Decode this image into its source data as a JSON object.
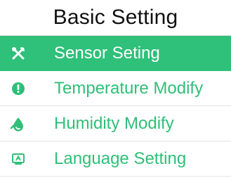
{
  "header": {
    "title": "Basic Setting"
  },
  "theme": {
    "accent": "#2fc07a",
    "active_text": "#ffffff",
    "text": "#2fbf78"
  },
  "menu": {
    "items": [
      {
        "label": "Sensor Seting",
        "icon": "tools-icon",
        "selected": true
      },
      {
        "label": "Temperature Modify",
        "icon": "thermometer-info-icon",
        "selected": false
      },
      {
        "label": "Humidity Modify",
        "icon": "droplet-icon",
        "selected": false
      },
      {
        "label": "Language Setting",
        "icon": "language-icon",
        "selected": false
      }
    ]
  }
}
